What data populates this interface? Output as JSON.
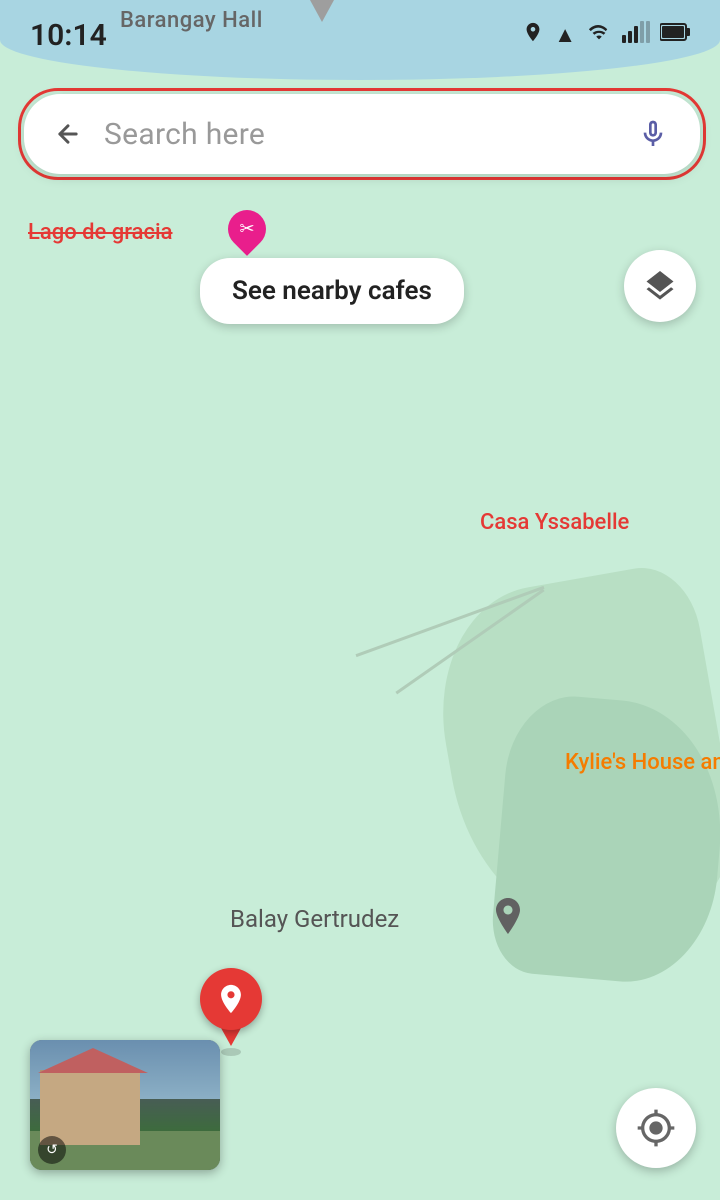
{
  "statusBar": {
    "time": "10:14",
    "icons": {
      "location": "◎",
      "signal_alt": "▲",
      "wifi": "wifi",
      "signal": "signal",
      "battery": "battery"
    }
  },
  "searchBar": {
    "placeholder": "Search here",
    "backLabel": "back",
    "micLabel": "microphone"
  },
  "map": {
    "labels": {
      "barangayHall": "Barangay Hall",
      "lagoDeGracia": "Lago de gracia",
      "casaYssabelle": "Casa Yssabelle",
      "kylieHouse": "Kylie's House and",
      "balayGertrudez": "Balay Gertrudez"
    },
    "backgroundColor": "#c8edd8",
    "waterColor": "#a8d5e2"
  },
  "buttons": {
    "nearbyCafes": "See nearby cafes",
    "layers": "layers",
    "myLocation": "my location"
  }
}
